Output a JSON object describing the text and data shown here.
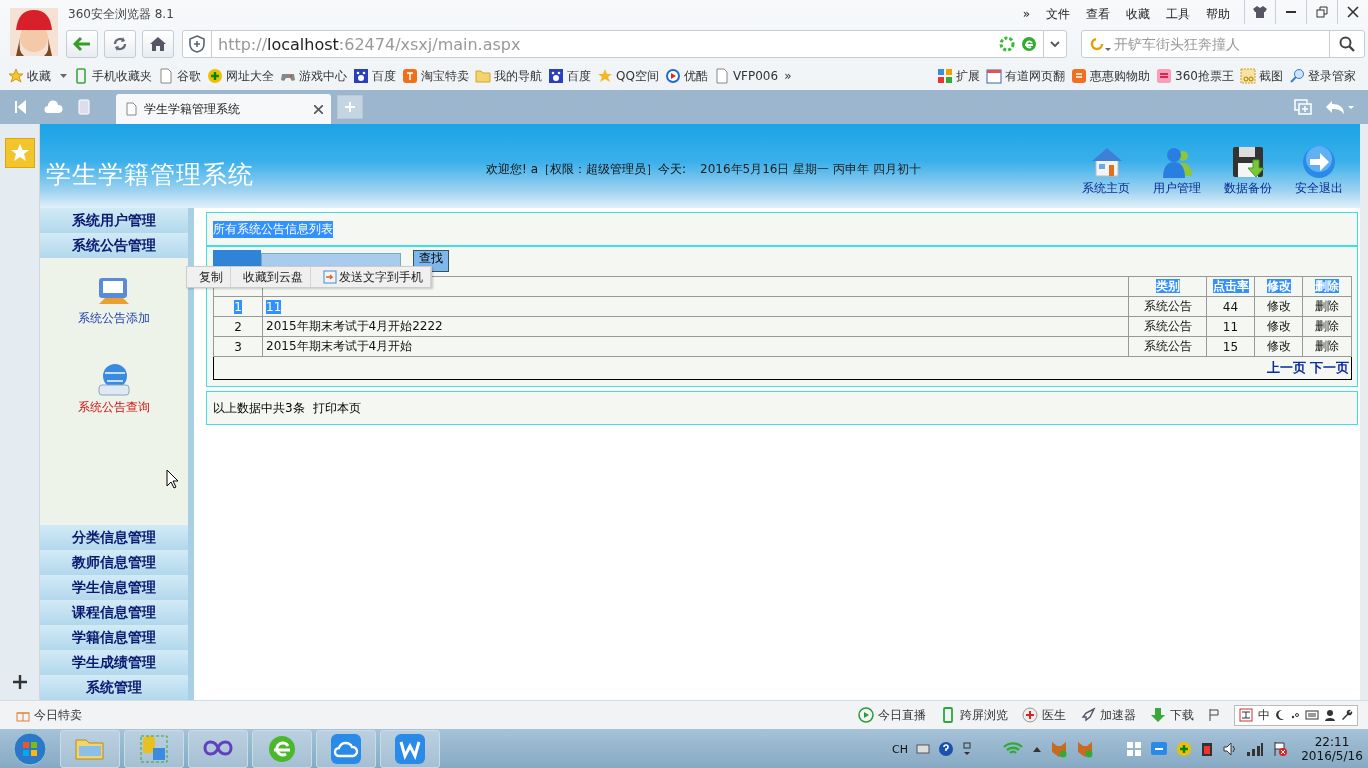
{
  "browser": {
    "title": "360安全浏览器 8.1",
    "menu": [
      "»",
      "文件",
      "查看",
      "收藏",
      "工具",
      "帮助"
    ],
    "url": {
      "scheme": "http://",
      "host": "localhost",
      "rest": ":62474/xsxj/main.aspx"
    },
    "search": {
      "placeholder": "开铲车街头狂奔撞人"
    },
    "bookmarks": [
      "收藏",
      "手机收藏夹",
      "谷歌",
      "网址大全",
      "游戏中心",
      "百度",
      "淘宝特卖",
      "我的导航",
      "百度",
      "QQ空间",
      "优酷",
      "VFP006",
      "»"
    ],
    "extensions": [
      "扩展",
      "有道网页翻",
      "惠惠购物助",
      "360抢票王",
      "截图",
      "登录管家"
    ],
    "tabs": [
      {
        "title": "学生学籍管理系统",
        "selected": true
      }
    ]
  },
  "header": {
    "title": "学生学籍管理系统",
    "welcome": "欢迎您! a［权限：超级管理员］今天:",
    "date": "2016年5月16日 星期一 丙申年 四月初十",
    "actions": [
      "系统主页",
      "用户管理",
      "数据备份",
      "安全退出"
    ]
  },
  "sidebar": {
    "sections": [
      {
        "label": "系统用户管理"
      },
      {
        "label": "系统公告管理",
        "children": [
          {
            "label": "系统公告添加",
            "selected": false
          },
          {
            "label": "系统公告查询",
            "selected": true
          }
        ]
      },
      {
        "label": "分类信息管理"
      },
      {
        "label": "教师信息管理"
      },
      {
        "label": "学生信息管理"
      },
      {
        "label": "课程信息管理"
      },
      {
        "label": "学籍信息管理"
      },
      {
        "label": "学生成绩管理"
      },
      {
        "label": "系统管理"
      }
    ]
  },
  "panel": {
    "title": "所有系统公告信息列表",
    "title_highlighted": true,
    "search_button": "查找",
    "columns": [
      "",
      "",
      "类别",
      "点击率",
      "修改",
      "删除"
    ],
    "header_highlighted": true,
    "rows": [
      {
        "cells": [
          "1",
          "11",
          "系统公告",
          "44",
          "修改",
          "删除"
        ],
        "highlighted": true
      },
      {
        "cells": [
          "2",
          "2015年期末考试于4月开始2222",
          "系统公告",
          "11",
          "修改",
          "删除"
        ],
        "highlighted": false
      },
      {
        "cells": [
          "3",
          "2015年期末考试于4月开始",
          "系统公告",
          "15",
          "修改",
          "删除"
        ],
        "highlighted": false
      }
    ],
    "pager": [
      "上一页",
      "下一页"
    ],
    "summary": "以上数据中共3条",
    "print": "打印本页"
  },
  "context_menu": [
    "复制",
    "收藏到云盘",
    "发送文字到手机"
  ],
  "status_bar": {
    "left": "今日特卖",
    "items": [
      "今日直播",
      "跨屏浏览",
      "医生",
      "加速器",
      "下载"
    ],
    "ime": "中"
  },
  "taskbar": {
    "lang": "CH",
    "time": "22:11",
    "date": "2016/5/16"
  }
}
